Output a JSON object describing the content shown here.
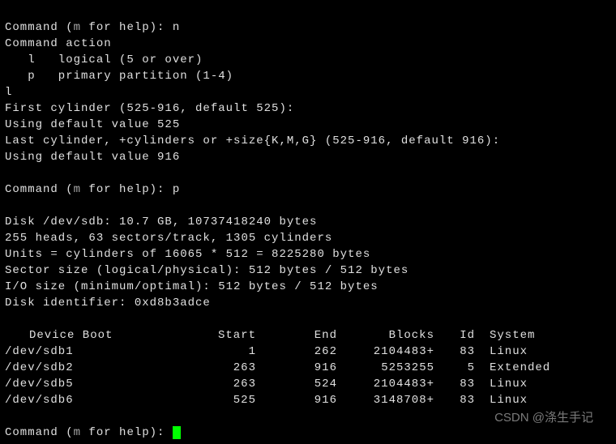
{
  "lines": {
    "l1a": "Command (",
    "l1b": "m",
    "l1c": " for help): n",
    "l2": "Command action",
    "l3": "   l   logical (5 or over)",
    "l4": "   p   primary partition (1-4)",
    "l5": "l",
    "l6": "First cylinder (525-916, default 525):",
    "l7": "Using default value 525",
    "l8": "Last cylinder, +cylinders or +size{K,M,G} (525-916, default 916):",
    "l9": "Using default value 916",
    "blank1": "",
    "l10a": "Command (",
    "l10b": "m",
    "l10c": " for help): p",
    "blank2": "",
    "l11": "Disk /dev/sdb: 10.7 GB, 10737418240 bytes",
    "l12": "255 heads, 63 sectors/track, 1305 cylinders",
    "l13": "Units = cylinders of 16065 * 512 = 8225280 bytes",
    "l14": "Sector size (logical/physical): 512 bytes / 512 bytes",
    "l15": "I/O size (minimum/optimal): 512 bytes / 512 bytes",
    "l16": "Disk identifier: 0xd8b3adce",
    "blank3": "",
    "blank4": "",
    "lfa": "Command (",
    "lfb": "m",
    "lfc": " for help): "
  },
  "table": {
    "headers": {
      "device": "Device Boot",
      "start": "Start",
      "end": "End",
      "blocks": "Blocks",
      "id": "Id",
      "system": "System"
    },
    "rows": [
      {
        "device": "/dev/sdb1",
        "start": "1",
        "end": "262",
        "blocks": "2104483+",
        "id": "83",
        "system": "Linux"
      },
      {
        "device": "/dev/sdb2",
        "start": "263",
        "end": "916",
        "blocks": "5253255",
        "id": "5",
        "system": "Extended"
      },
      {
        "device": "/dev/sdb5",
        "start": "263",
        "end": "524",
        "blocks": "2104483+",
        "id": "83",
        "system": "Linux"
      },
      {
        "device": "/dev/sdb6",
        "start": "525",
        "end": "916",
        "blocks": "3148708+",
        "id": "83",
        "system": "Linux"
      }
    ]
  },
  "watermark": "CSDN @涤生手记"
}
